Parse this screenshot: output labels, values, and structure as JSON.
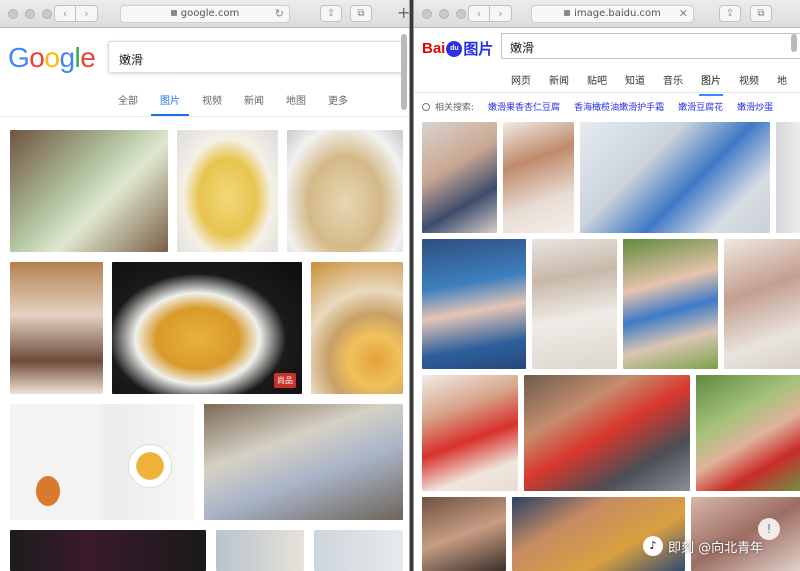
{
  "left_window": {
    "url": "google.com",
    "logo": {
      "letters": [
        "G",
        "o",
        "o",
        "g",
        "l",
        "e"
      ],
      "colors": [
        "#4285F4",
        "#EA4335",
        "#FBBC05",
        "#4285F4",
        "#34A853",
        "#EA4335"
      ]
    },
    "search_query": "嫩滑",
    "tabs": [
      "全部",
      "图片",
      "视频",
      "新闻",
      "地图",
      "更多"
    ],
    "active_tab": "图片",
    "image_badge": "尚品"
  },
  "right_window": {
    "url": "image.baidu.com",
    "logo": {
      "bai": "Bai",
      "du": "du",
      "img": "图片"
    },
    "search_query": "嫩滑",
    "tabs": [
      "网页",
      "新闻",
      "贴吧",
      "知道",
      "音乐",
      "图片",
      "视频",
      "地"
    ],
    "active_tab": "图片",
    "related_label": "相关搜索:",
    "related_items": [
      "嫩滑果香杏仁豆腐",
      "香海橄榄油嫩滑护手霜",
      "嫩滑豆腐花",
      "嫩滑炒蛋"
    ]
  },
  "watermark": {
    "logo": "♪",
    "text": "即刻 @向北青年"
  },
  "accent": {
    "google_blue": "#1a73e8",
    "baidu_blue": "#2932e1",
    "baidu_red": "#e10602"
  }
}
